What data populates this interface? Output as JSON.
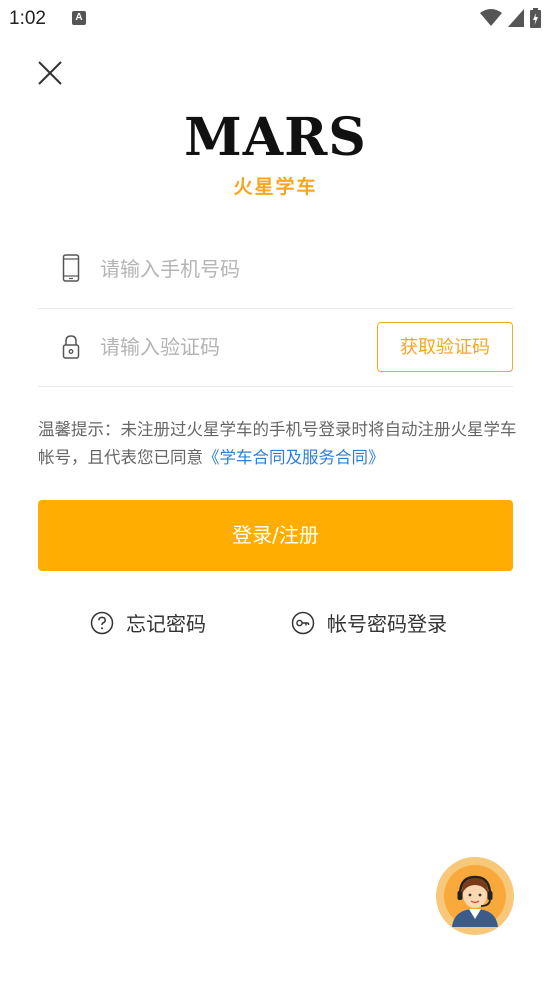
{
  "status_bar": {
    "time": "1:02",
    "notification_icon": "A"
  },
  "logo": {
    "brand": "MARS",
    "subtitle": "火星学车"
  },
  "phone_field": {
    "placeholder": "请输入手机号码"
  },
  "code_field": {
    "placeholder": "请输入验证码",
    "get_code_label": "获取验证码"
  },
  "notice": {
    "text": "温馨提示：未注册过火星学车的手机号登录时将自动注册火星学车帐号，且代表您已同意",
    "link": "《学车合同及服务合同》"
  },
  "login_button": {
    "label": "登录/注册"
  },
  "alt_actions": {
    "forgot_password": "忘记密码",
    "account_login": "帐号密码登录"
  },
  "colors": {
    "accent": "#ffad00",
    "link": "#2f7fd8"
  }
}
